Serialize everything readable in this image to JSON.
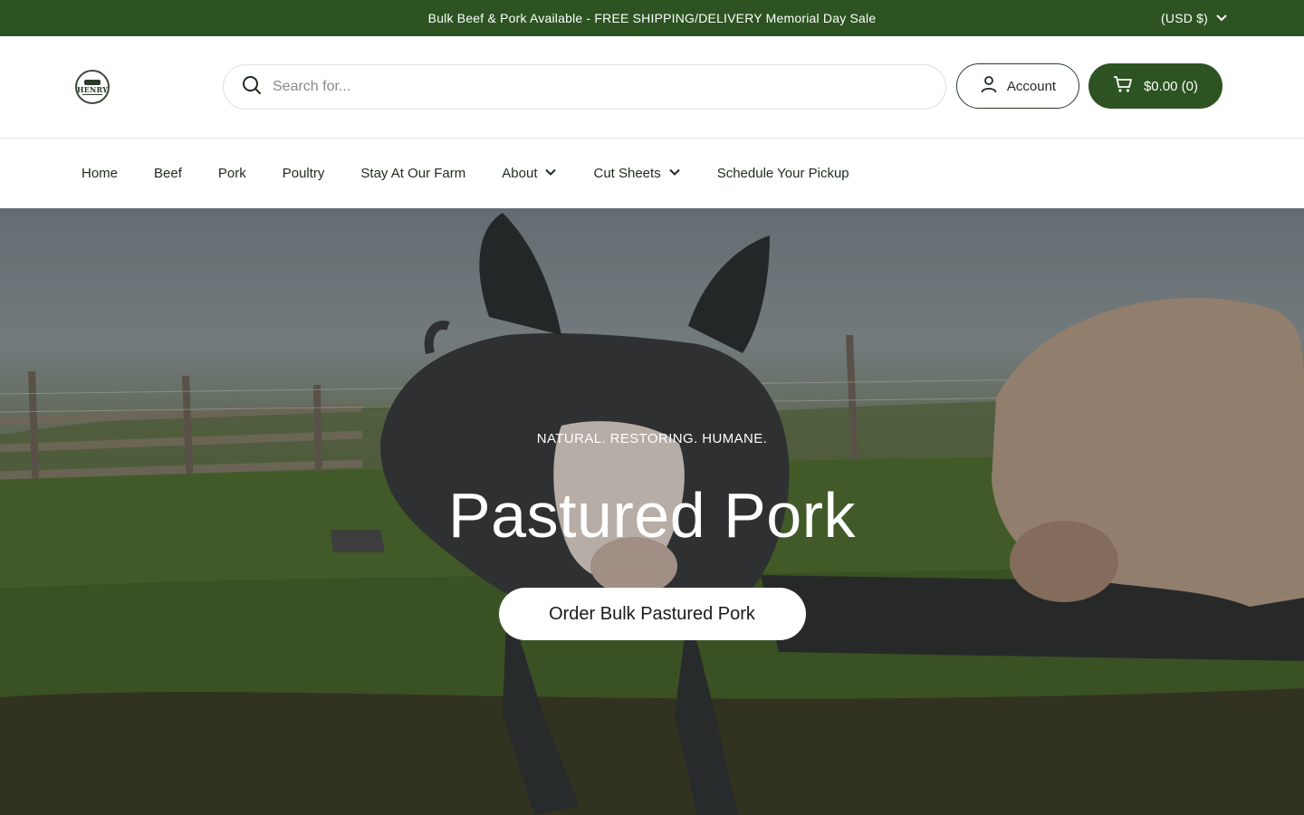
{
  "announcement": {
    "text": "Bulk Beef & Pork Available - FREE SHIPPING/DELIVERY Memorial Day Sale",
    "currency_label": "(USD $)",
    "currency_icon": "chevron-down-icon"
  },
  "header": {
    "logo_text": "HENRY",
    "search": {
      "placeholder": "Search for...",
      "value": "",
      "icon": "search-icon"
    },
    "account_label": "Account",
    "account_icon": "user-icon",
    "cart_label": "$0.00 (0)",
    "cart_icon": "cart-icon"
  },
  "nav": {
    "items": [
      {
        "label": "Home"
      },
      {
        "label": "Beef"
      },
      {
        "label": "Pork"
      },
      {
        "label": "Poultry"
      },
      {
        "label": "Stay At Our Farm"
      },
      {
        "label": "About",
        "dropdown": true
      },
      {
        "label": "Cut Sheets",
        "dropdown": true
      },
      {
        "label": "Schedule Your Pickup"
      }
    ]
  },
  "hero": {
    "eyebrow": "NATURAL. RESTORING. HUMANE.",
    "headline": "Pastured Pork",
    "cta_label": "Order Bulk Pastured Pork"
  },
  "colors": {
    "brand_green": "#2c5321",
    "text_dark": "#1f2a1f",
    "white": "#ffffff"
  }
}
